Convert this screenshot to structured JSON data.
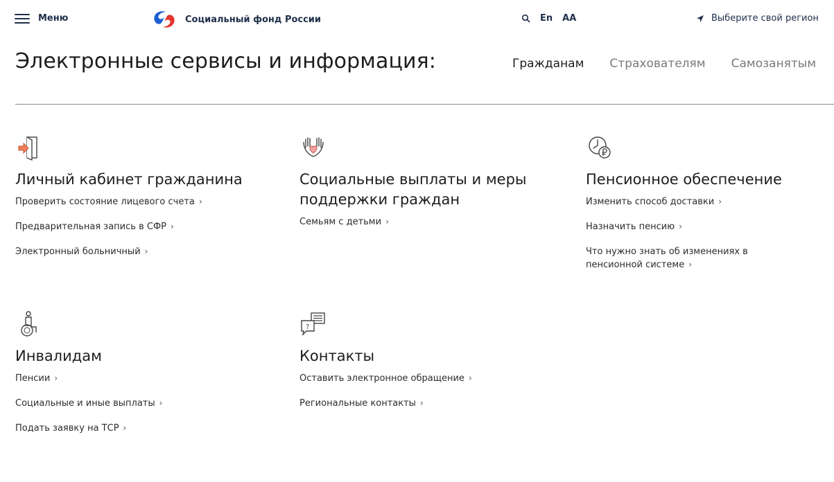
{
  "header": {
    "menu_label": "Меню",
    "logo_text": "Социальный фонд России",
    "lang_label": "En",
    "font_size_label": "AA",
    "region_label": "Выберите свой регион",
    "brand_colors": {
      "blue": "#1d5fd1",
      "red": "#e3342f"
    }
  },
  "main": {
    "title": "Электронные сервисы и информация:",
    "tabs": [
      {
        "label": "Гражданам",
        "active": true
      },
      {
        "label": "Страхователям",
        "active": false
      },
      {
        "label": "Самозанятым",
        "active": false
      }
    ]
  },
  "cards": [
    {
      "icon": "door-entry-icon",
      "title": "Личный кабинет гражданина",
      "links": [
        "Проверить состояние лицевого счета",
        "Предварительная запись в СФР",
        "Электронный больничный"
      ]
    },
    {
      "icon": "hands-heart-icon",
      "title": "Социальные выплаты и меры поддержки граждан",
      "links": [
        "Семьям с детьми"
      ]
    },
    {
      "icon": "clock-ruble-icon",
      "title": "Пенсионное обеспечение",
      "links": [
        "Изменить способ доставки",
        "Назначить пенсию",
        "Что нужно знать об изменениях в пенсионной системе"
      ]
    },
    {
      "icon": "wheelchair-icon",
      "title": "Инвалидам",
      "links": [
        "Пенсии",
        "Социальные и иные выплаты",
        "Подать заявку на ТСР"
      ]
    },
    {
      "icon": "chat-question-icon",
      "title": "Контакты",
      "links": [
        "Оставить электронное обращение",
        "Региональные контакты"
      ]
    }
  ],
  "link_arrow": "›"
}
